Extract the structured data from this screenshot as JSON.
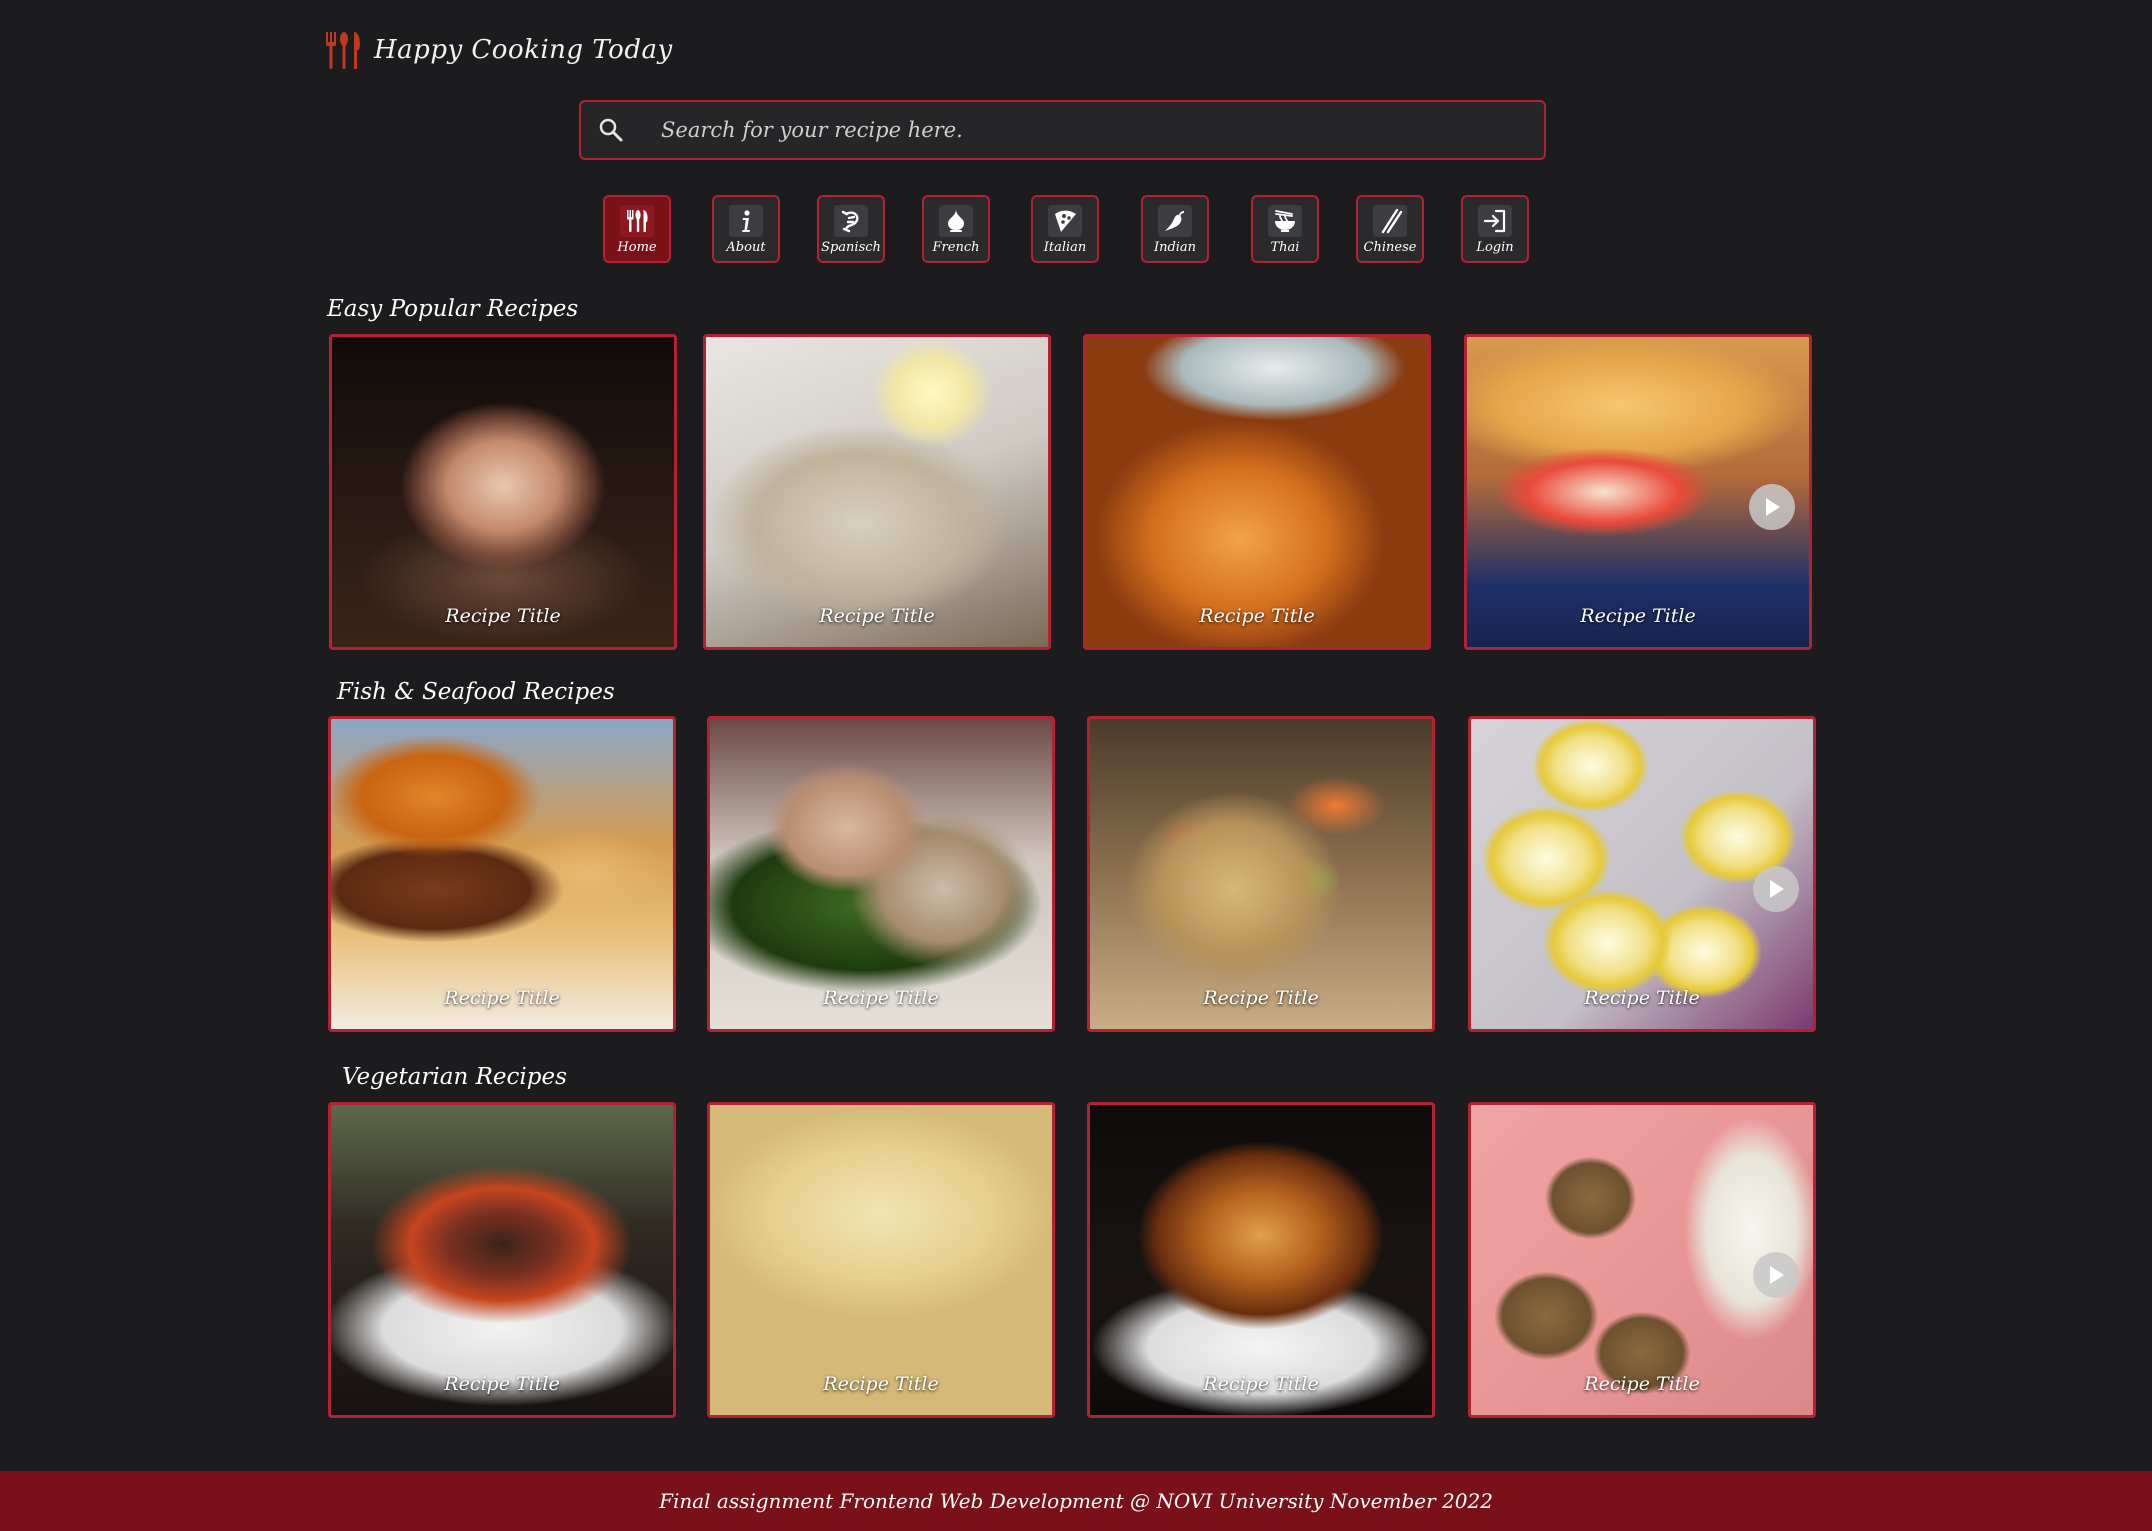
{
  "header": {
    "app_title": "Happy Cooking Today",
    "logo_icon": "fork-spoon-knife-icon"
  },
  "search": {
    "placeholder": "Search for your recipe here.",
    "icon": "search-icon"
  },
  "nav": {
    "items": [
      {
        "label": "Home",
        "icon": "cutlery-icon",
        "active": true
      },
      {
        "label": "About",
        "icon": "info-icon",
        "active": false
      },
      {
        "label": "Spanisch",
        "icon": "shrimp-icon",
        "active": false
      },
      {
        "label": "French",
        "icon": "garlic-icon",
        "active": false
      },
      {
        "label": "Italian",
        "icon": "pizza-icon",
        "active": false
      },
      {
        "label": "Indian",
        "icon": "chili-pepper-icon",
        "active": false
      },
      {
        "label": "Thai",
        "icon": "noodle-bowl-icon",
        "active": false
      },
      {
        "label": "Chinese",
        "icon": "chopsticks-icon",
        "active": false
      },
      {
        "label": "Login",
        "icon": "login-icon",
        "active": false
      }
    ]
  },
  "sections": [
    {
      "title": "Easy Popular Recipes",
      "cards": [
        {
          "title": "Recipe Title",
          "video": false
        },
        {
          "title": "Recipe Title",
          "video": false
        },
        {
          "title": "Recipe Title",
          "video": false
        },
        {
          "title": "Recipe Title",
          "video": true
        }
      ]
    },
    {
      "title": "Fish & Seafood Recipes",
      "cards": [
        {
          "title": "Recipe Title",
          "video": false
        },
        {
          "title": "Recipe Title",
          "video": false
        },
        {
          "title": "Recipe Title",
          "video": false
        },
        {
          "title": "Recipe Title",
          "video": true
        }
      ]
    },
    {
      "title": "Vegetarian Recipes",
      "cards": [
        {
          "title": "Recipe Title",
          "video": false
        },
        {
          "title": "Recipe Title",
          "video": false
        },
        {
          "title": "Recipe Title",
          "video": false
        },
        {
          "title": "Recipe Title",
          "video": true
        }
      ]
    }
  ],
  "footer": {
    "text": "Final assignment Frontend Web Development @ NOVI University November 2022"
  },
  "colors": {
    "background": "#1c1b1e",
    "accent_border": "#b22232",
    "active_nav": "#7a1118",
    "footer_bg": "#7a1118"
  }
}
